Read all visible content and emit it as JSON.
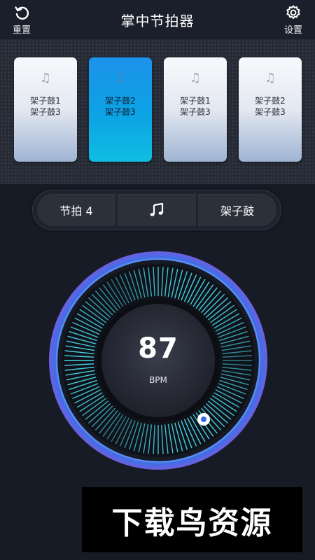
{
  "header": {
    "title": "掌中节拍器",
    "reset_label": "重置",
    "settings_label": "设置"
  },
  "beats": [
    {
      "line1": "架子鼓1",
      "line2": "架子鼓3",
      "active": false
    },
    {
      "line1": "架子鼓2",
      "line2": "架子鼓3",
      "active": true
    },
    {
      "line1": "架子鼓1",
      "line2": "架子鼓3",
      "active": false
    },
    {
      "line1": "架子鼓2",
      "line2": "架子鼓3",
      "active": false
    }
  ],
  "controls": {
    "beat_label": "节拍 4",
    "sound_label": "架子鼓"
  },
  "dial": {
    "bpm": "87",
    "unit": "BPM"
  },
  "watermark": {
    "text": "下载鸟资源"
  },
  "colors": {
    "background": "#171b26",
    "active_card": "#0ea5e6",
    "ring_glow": "#4a7ff0",
    "tick": "#46d3e6",
    "knob_dot": "#2f6be8"
  },
  "icons": {
    "reset": "refresh-icon",
    "settings": "gear-icon",
    "note": "music-note-icon"
  }
}
